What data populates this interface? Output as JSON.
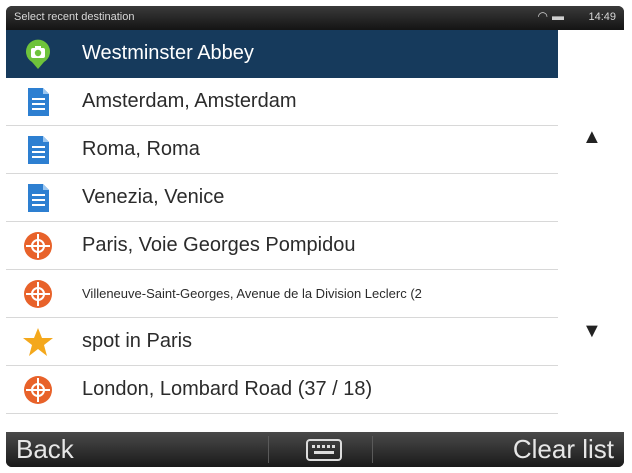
{
  "status_bar": {
    "title": "Select recent destination",
    "time": "14:49",
    "icons": [
      "wifi-icon",
      "battery-icon"
    ]
  },
  "destinations": [
    {
      "label": "Westminster Abbey",
      "icon": "camera-pin-icon",
      "selected": true
    },
    {
      "label": "Amsterdam, Amsterdam",
      "icon": "document-icon"
    },
    {
      "label": "Roma, Roma",
      "icon": "document-icon"
    },
    {
      "label": "Venezia, Venice",
      "icon": "document-icon"
    },
    {
      "label": "Paris, Voie Georges Pompidou",
      "icon": "crosshair-icon"
    },
    {
      "label": "Villeneuve-Saint-Georges, Avenue de la Division Leclerc (2",
      "icon": "crosshair-icon"
    },
    {
      "label": "spot in Paris",
      "icon": "star-icon"
    },
    {
      "label": "London, Lombard Road (37 / 18)",
      "icon": "crosshair-icon"
    }
  ],
  "scroll": {
    "up_icon": "scroll-up-icon",
    "down_icon": "scroll-down-icon"
  },
  "bottom_bar": {
    "back_label": "Back",
    "keyboard_icon": "keyboard-icon",
    "clear_label": "Clear list"
  },
  "colors": {
    "selection": "#163a5c",
    "green": "#6ec33b",
    "blue": "#2d7fd1",
    "orange": "#e8622a",
    "star": "#f4a81c"
  }
}
